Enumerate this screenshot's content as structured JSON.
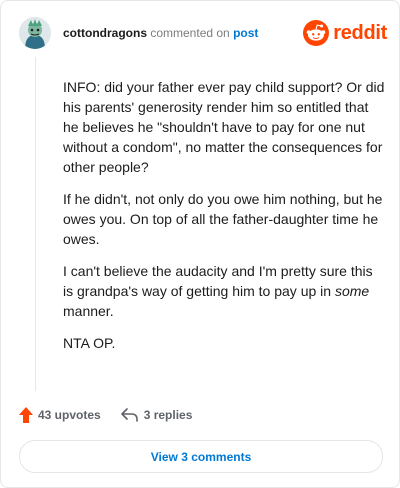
{
  "header": {
    "username": "cottondragons",
    "action": "commented on",
    "target": "post",
    "brand": "reddit"
  },
  "comment": {
    "paragraph_1": "INFO: did your father ever pay child support? Or did his parents' generosity render him so entitled that he believes he \"shouldn't have to pay for one nut without a condom\", no matter the consequences for other people?",
    "paragraph_2": "If he didn't, not only do you owe him nothing, but he owes you. On top of all the father-daughter time he owes.",
    "paragraph_3_before": "I can't believe the audacity and I'm pretty sure this is grandpa's way of getting him to pay up in ",
    "paragraph_3_emphasis": "some",
    "paragraph_3_after": " manner.",
    "paragraph_4": "NTA OP."
  },
  "footer": {
    "upvotes": "43 upvotes",
    "replies": "3 replies",
    "view_comments": "View 3 comments"
  },
  "icons": {
    "avatar": "user-avatar",
    "brand_logo": "reddit-snoo-icon",
    "upvote": "upvote-arrow-icon",
    "reply": "reply-arrow-icon"
  },
  "colors": {
    "brand": "#ff4500",
    "link": "#0079d3",
    "upvote": "#ff4500",
    "meta_gray": "#7c7c7c"
  }
}
